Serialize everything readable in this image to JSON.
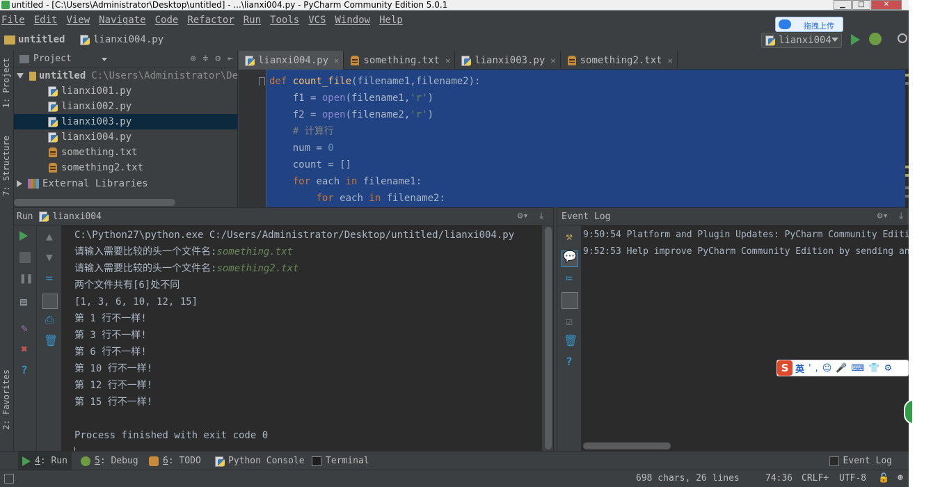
{
  "window": {
    "title": "untitled - [C:\\Users\\Administrator\\Desktop\\untitled] - ...\\lianxi004.py - PyCharm Community Edition 5.0.1",
    "min_label": "▁",
    "max_label": "□",
    "close_label": "✕"
  },
  "menu": [
    "File",
    "Edit",
    "View",
    "Navigate",
    "Code",
    "Refactor",
    "Run",
    "Tools",
    "VCS",
    "Window",
    "Help"
  ],
  "baidu_bubble": {
    "label": "拖拽上传"
  },
  "navbar": {
    "project": "untitled",
    "file": "lianxi004.py",
    "run_config": "lianxi004"
  },
  "left_strip": {
    "project_tab": "1: Project",
    "structure_tab": "7: Structure",
    "favorites_tab": "2: Favorites"
  },
  "project_panel": {
    "title": "Project",
    "root": {
      "name": "untitled",
      "path": "C:\\Users\\Administrator\\De"
    },
    "files": [
      {
        "name": "lianxi001.py",
        "type": "py"
      },
      {
        "name": "lianxi002.py",
        "type": "py"
      },
      {
        "name": "lianxi003.py",
        "type": "py",
        "selected": true
      },
      {
        "name": "lianxi004.py",
        "type": "py"
      },
      {
        "name": "something.txt",
        "type": "txt"
      },
      {
        "name": "something2.txt",
        "type": "txt"
      }
    ],
    "external": "External Libraries"
  },
  "editor_tabs": [
    {
      "label": "lianxi004.py",
      "type": "py",
      "active": true
    },
    {
      "label": "something.txt",
      "type": "txt"
    },
    {
      "label": "lianxi003.py",
      "type": "py"
    },
    {
      "label": "something2.txt",
      "type": "txt"
    }
  ],
  "code_lines": [
    "def count_file(filename1,filename2):",
    "    f1 = open(filename1,'r')",
    "    f2 = open(filename2,'r')",
    "    # 计算行",
    "    num = 0",
    "    count = []",
    "    for each in filename1:",
    "        for each in filename2:"
  ],
  "run_panel": {
    "title": "Run",
    "config": "lianxi004",
    "output": [
      {
        "text": "C:\\Python27\\python.exe C:/Users/Administrator/Desktop/untitled/lianxi004.py"
      },
      {
        "text": "请输入需要比较的头一个文件名:",
        "input": "something.txt"
      },
      {
        "text": "请输入需要比较的头一个文件名:",
        "input": "something2.txt"
      },
      {
        "text": "两个文件共有[6]处不同"
      },
      {
        "text": "[1, 3, 6, 10, 12, 15]"
      },
      {
        "text": "第 1 行不一样!"
      },
      {
        "text": "第 3 行不一样!"
      },
      {
        "text": "第 6 行不一样!"
      },
      {
        "text": "第 10 行不一样!"
      },
      {
        "text": "第 12 行不一样!"
      },
      {
        "text": "第 15 行不一样!"
      },
      {
        "text": ""
      },
      {
        "text": "Process finished with exit code 0"
      }
    ]
  },
  "event_log": {
    "title": "Event Log",
    "entries": [
      {
        "time": "9:50:54",
        "text": "Platform and Plugin Updates: PyCharm Community Editi"
      },
      {
        "time": "9:52:53",
        "text": "Help improve PyCharm Community Edition by sending an"
      }
    ]
  },
  "ime": {
    "mode": "英",
    "items": [
      "'",
      ",",
      "☺",
      "🎤",
      "⌨",
      "👕",
      "⚙"
    ]
  },
  "tool_windows": [
    {
      "key": "4",
      "label": ": Run",
      "icon": "run-icon"
    },
    {
      "key": "5",
      "label": ": Debug",
      "icon": "debug-icon"
    },
    {
      "key": "6",
      "label": ": TODO",
      "icon": "todo-icon"
    },
    {
      "key": "",
      "label": "Python Console",
      "icon": "python-console-icon"
    },
    {
      "key": "",
      "label": "Terminal",
      "icon": "terminal-icon"
    }
  ],
  "event_log_tab": "Event Log",
  "status": {
    "chars": "698 chars, 26 lines",
    "position": "74:36",
    "line_sep": "CRLF÷",
    "encoding": "UTF-8"
  },
  "colors": {
    "background": "#3c3f41",
    "editor_bg": "#2b2b2b",
    "selection": "#214283",
    "keyword": "#cc7832",
    "function": "#ffc66d",
    "string": "#6a8759",
    "run_green": "#499c54"
  }
}
